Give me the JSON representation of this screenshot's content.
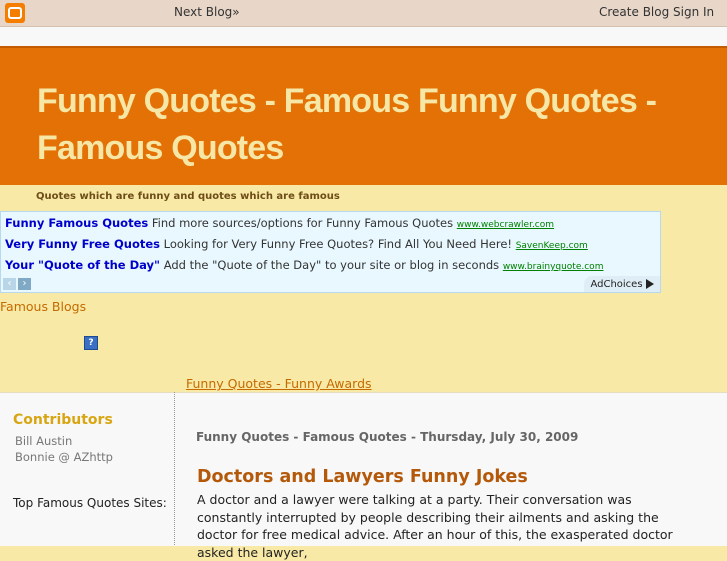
{
  "navbar": {
    "next_blog": "Next Blog»",
    "create_blog": "Create Blog",
    "sign_in": "Sign In"
  },
  "header": {
    "title": "Funny Quotes - Famous Funny Quotes - Famous Quotes",
    "description": "Quotes which are funny and quotes which are famous"
  },
  "ads": [
    {
      "title": "Funny Famous Quotes",
      "text": "Find more sources/options for Funny Famous Quotes",
      "url": "www.webcrawler.com"
    },
    {
      "title": "Very Funny Free Quotes",
      "text": "Looking for Very Funny Free Quotes? Find All You Need Here!",
      "url": "SavenKeep.com"
    },
    {
      "title": "Your \"Quote of the Day\"",
      "text": "Add the \"Quote of the Day\" to your site or blog in seconds",
      "url": "www.brainyquote.com"
    }
  ],
  "adchoices": "AdChoices",
  "links": {
    "famous_blogs": "Famous Blogs",
    "help": "?",
    "awards": "Funny Quotes - Funny Awards"
  },
  "sidebar": {
    "contributors_heading": "Contributors",
    "contributors": [
      "Bill Austin",
      "Bonnie @ AZhttp"
    ],
    "top_sites": "Top Famous Quotes Sites:"
  },
  "post": {
    "date_header": "Funny Quotes - Famous Quotes - Thursday, July 30, 2009",
    "title": "Doctors and Lawyers Funny Jokes",
    "body": "A doctor and a lawyer were talking at a party. Their conversation was constantly interrupted by people describing their ailments and asking the doctor for free medical advice. After an hour of this, the exasperated doctor asked the lawyer,"
  }
}
